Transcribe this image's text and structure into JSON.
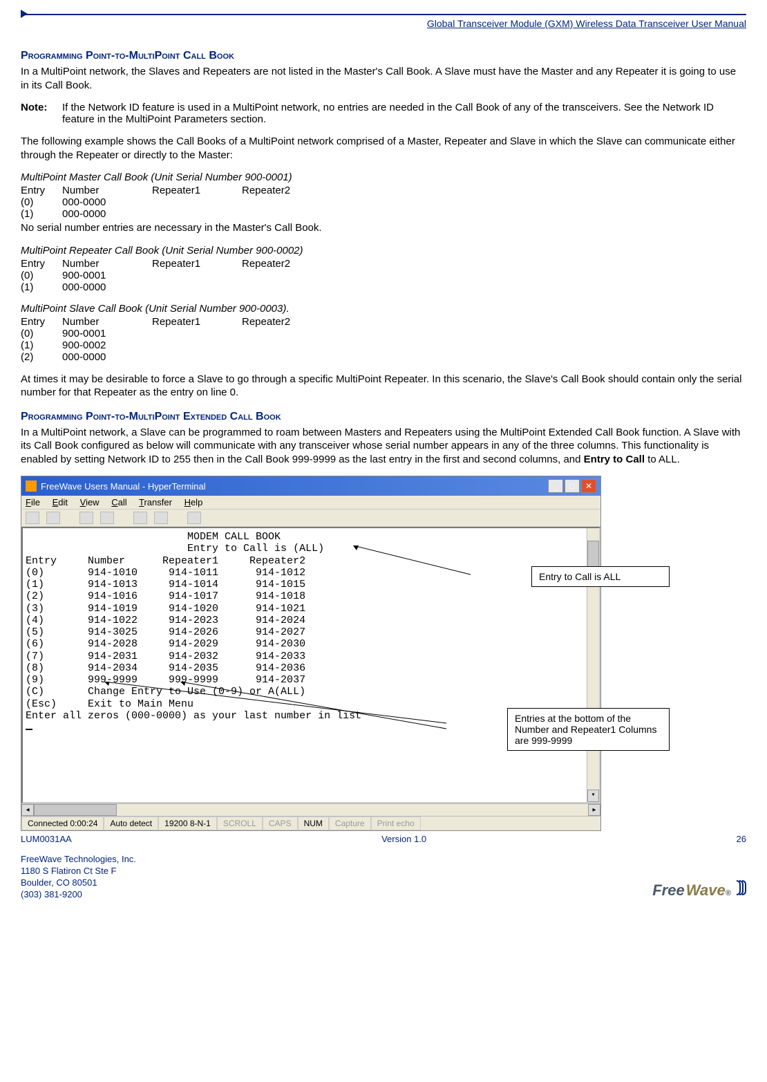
{
  "header": {
    "title": "Global Transceiver Module (GXM) Wireless Data Transceiver User Manual"
  },
  "section1": {
    "heading": "Programming Point-to-MultiPoint Call Book",
    "para1": "In a MultiPoint network, the Slaves and Repeaters are not listed in the Master's Call Book.  A Slave must have the Master and any Repeater it is going to use in its Call Book.",
    "note_label": "Note:",
    "note_text": "If the Network ID feature is used in a MultiPoint network, no entries are needed in the Call Book of any of the transceivers. See the Network ID feature in the MultiPoint Parameters section.",
    "para2": "The following example shows the Call Books of a MultiPoint network comprised of a Master, Repeater and Slave in which the Slave can communicate either through the Repeater or directly to the Master:",
    "master_title": "MultiPoint Master Call Book (Unit Serial Number 900-0001)",
    "headers": {
      "c1": "Entry",
      "c2": "Number",
      "c3": "Repeater1",
      "c4": "Repeater2"
    },
    "master_rows": [
      {
        "c1": "(0)",
        "c2": "000-0000"
      },
      {
        "c1": "(1)",
        "c2": "000-0000"
      }
    ],
    "master_note": "No serial number entries are necessary in the Master's Call Book.",
    "repeater_title": "MultiPoint Repeater Call Book (Unit Serial Number 900-0002)",
    "repeater_rows": [
      {
        "c1": "(0)",
        "c2": "900-0001"
      },
      {
        "c1": "(1)",
        "c2": "000-0000"
      }
    ],
    "slave_title": "MultiPoint Slave Call Book (Unit Serial Number 900-0003).",
    "slave_rows": [
      {
        "c1": "(0)",
        "c2": "900-0001"
      },
      {
        "c1": "(1)",
        "c2": "900-0002"
      },
      {
        "c1": "(2)",
        "c2": "000-0000"
      }
    ],
    "para3": "At times it may be desirable to force a Slave to go through a specific MultiPoint Repeater. In this scenario, the Slave's Call Book should contain only the serial number for that Repeater as the entry on line 0."
  },
  "section2": {
    "heading": "Programming Point-to-MultiPoint Extended Call Book",
    "para1_prefix": "In a MultiPoint network, a Slave can be programmed to roam between Masters and Repeaters using the MultiPoint Extended Call Book function.  A Slave with its Call Book configured as below will communicate with any transceiver whose serial number appears in any of the three columns.  This functionality is enabled by setting Network ID to 255 then in the Call Book 999-9999 as the last entry in the first and second columns, and ",
    "para1_bold": "Entry to Call",
    "para1_suffix": " to ALL."
  },
  "screenshot": {
    "title": "FreeWave Users Manual - HyperTerminal",
    "menu": [
      "File",
      "Edit",
      "View",
      "Call",
      "Transfer",
      "Help"
    ],
    "terminal_lines": [
      "                          MODEM CALL BOOK",
      "                          Entry to Call is (ALL)",
      "Entry     Number      Repeater1     Repeater2",
      "(0)       914-1010     914-1011      914-1012",
      "(1)       914-1013     914-1014      914-1015",
      "(2)       914-1016     914-1017      914-1018",
      "(3)       914-1019     914-1020      914-1021",
      "(4)       914-1022     914-2023      914-2024",
      "(5)       914-3025     914-2026      914-2027",
      "(6)       914-2028     914-2029      914-2030",
      "(7)       914-2031     914-2032      914-2033",
      "(8)       914-2034     914-2035      914-2036",
      "(9)       999-9999     999-9999      914-2037",
      "(C)       Change Entry to Use (0-9) or A(ALL)",
      "(Esc)     Exit to Main Menu",
      "Enter all zeros (000-0000) as your last number in list"
    ],
    "status": {
      "connected": "Connected 0:00:24",
      "detect": "Auto detect",
      "baud": "19200 8-N-1",
      "scroll": "SCROLL",
      "caps": "CAPS",
      "num": "NUM",
      "capture": "Capture",
      "echo": "Print echo"
    },
    "callout1": "Entry to Call is ALL",
    "callout2": "Entries at the bottom of the Number and Repeater1 Columns are 999-9999"
  },
  "footer": {
    "docid": "LUM0031AA",
    "version": "Version 1.0",
    "page": "26",
    "addr1": "FreeWave Technologies, Inc.",
    "addr2": "1180 S Flatiron Ct Ste F",
    "addr3": "Boulder, CO 80501",
    "addr4": "(303) 381-9200",
    "logo_a": "Free",
    "logo_b": "Wave"
  }
}
